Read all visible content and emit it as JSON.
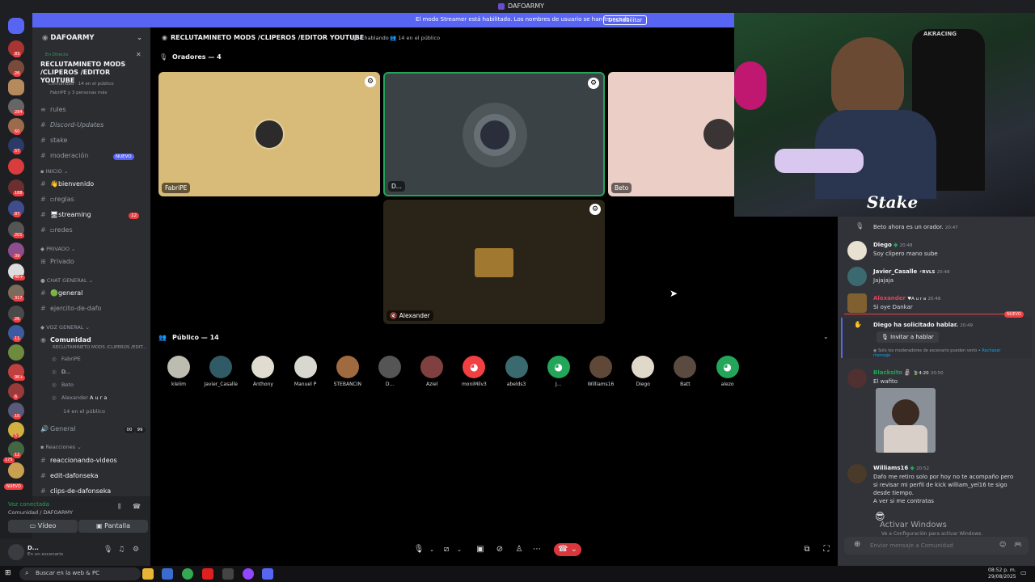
{
  "window": {
    "title": "DAFOARMY"
  },
  "banner": {
    "text": "El modo Streamer está habilitado. Los nombres de usuario se han truncado.",
    "button": "Deshabilitar"
  },
  "rail": {
    "badges": [
      "83",
      "26",
      "284",
      "60",
      "57",
      "188",
      "87",
      "201",
      "39",
      "4K+",
      "317",
      "26",
      "11",
      "9K+",
      "6",
      "10",
      "5",
      "12",
      "175"
    ],
    "nuevo": "NUEVO"
  },
  "sidebar": {
    "server_name": "DAFOARMY",
    "live_tag": "En Directo",
    "live_title": "RECLUTAMINETO MODS /CLIPEROS /EDITOR YOUTUBE",
    "live_meta": "Comunidad · 14 en el público",
    "live_people": "FabriPE y 3 personas más",
    "channels": [
      {
        "name": "rules",
        "type": "text"
      },
      {
        "name": "Discord-Updates",
        "type": "text"
      },
      {
        "name": "stake",
        "type": "text"
      },
      {
        "name": "moderación",
        "type": "text",
        "badge": "NUEVO"
      }
    ],
    "cat_inicio": "INICIO",
    "inicio": [
      {
        "name": "bienvenido",
        "bright": true
      },
      {
        "name": "reglas"
      },
      {
        "name": "streaming",
        "bright": true,
        "badge": "12"
      },
      {
        "name": "redes"
      }
    ],
    "cat_privado": "PRIVADO",
    "privado": "Privado",
    "cat_chat": "CHAT GENERAL",
    "chat": [
      {
        "name": "general",
        "bright": true
      },
      {
        "name": "ejercito-de-dafo"
      }
    ],
    "cat_voz": "VOZ GENERAL",
    "voz_channel": "Comunidad",
    "voz_sub": "RECLUTAMINETO MODS /CLIPEROS /EDIT...",
    "voz_members": [
      "FabriPE",
      "D...",
      "Beto",
      "Alexander"
    ],
    "voz_alex_tag": "A u r a",
    "voz_audience": "14 en el público",
    "general_voice": "General",
    "general_counts": [
      "00",
      "99"
    ],
    "cat_reacciones": "Reacciones",
    "reacciones": [
      "reaccionando-videos",
      "edit-dafonseka",
      "clips-de-dafonseka"
    ]
  },
  "voice_panel": {
    "status": "Voz conectada",
    "location": "Comunidad / DAFOARMY",
    "video": "Vídeo",
    "pantalla": "Pantalla"
  },
  "user_panel": {
    "name": "D...",
    "status": "En un escenario"
  },
  "stage": {
    "title": "RECLUTAMINETO MODS /CLIPEROS /EDITOR YOUTUBE",
    "hablando": "4 hablando",
    "publico_count": "14 en el público",
    "oradores": "Oradores — 4",
    "speakers": [
      "FabriPE",
      "D...",
      "Beto",
      "Alexander"
    ],
    "publico": "Público — 14",
    "audience": [
      "klelim",
      "Javier_Casalle",
      "Anthony",
      "Manuel P",
      "STEBANCIN",
      "D...",
      "Aziel",
      "moniMilv3",
      "abelds3",
      "J...",
      "Williams16",
      "Diego",
      "Batt",
      "alezo"
    ]
  },
  "cam": {
    "brand": "Stake",
    "chair": "AKRACING"
  },
  "chat": {
    "system1": "Beto ahora es un orador.",
    "system1_time": "20:47",
    "messages": [
      {
        "user": "Diego",
        "time": "20:48",
        "text": "Soy clipero mano sube"
      },
      {
        "user": "Javier_Casalle",
        "tag": "RVLS",
        "time": "20:48",
        "text": "Jajajaja"
      },
      {
        "user": "Alexander",
        "tag": "A u r a",
        "time": "20:48",
        "text": "Si oye Dankar"
      }
    ],
    "nuevo": "NUEVO",
    "request": "Diego ha solicitado hablar.",
    "request_time": "20:49",
    "invite": "Invitar a hablar",
    "mod_note": "Solo los moderadores de escenario pueden verlo •",
    "reject": "Rechazar mensaje",
    "blacksito": {
      "user": "Blacksito 🗿",
      "tag": "4:20",
      "time": "20:50",
      "text": "El wafito"
    },
    "williams": {
      "user": "Williams16",
      "time": "20:52",
      "text": "Dafo me retiro solo por hoy no te acompaño pero si revisar mi perfil de kick william_yel16 te sigo desde tiempo.",
      "text2": "A ver si me contratas"
    },
    "activar": "Activar Windows",
    "activar_sub": "Ve a Configuración para activar Windows.",
    "placeholder": "Enviar mensaje a Comunidad"
  },
  "taskbar": {
    "search": "Buscar en la web & PC",
    "time": "08:52 p. m.",
    "date": "29/08/2025"
  }
}
